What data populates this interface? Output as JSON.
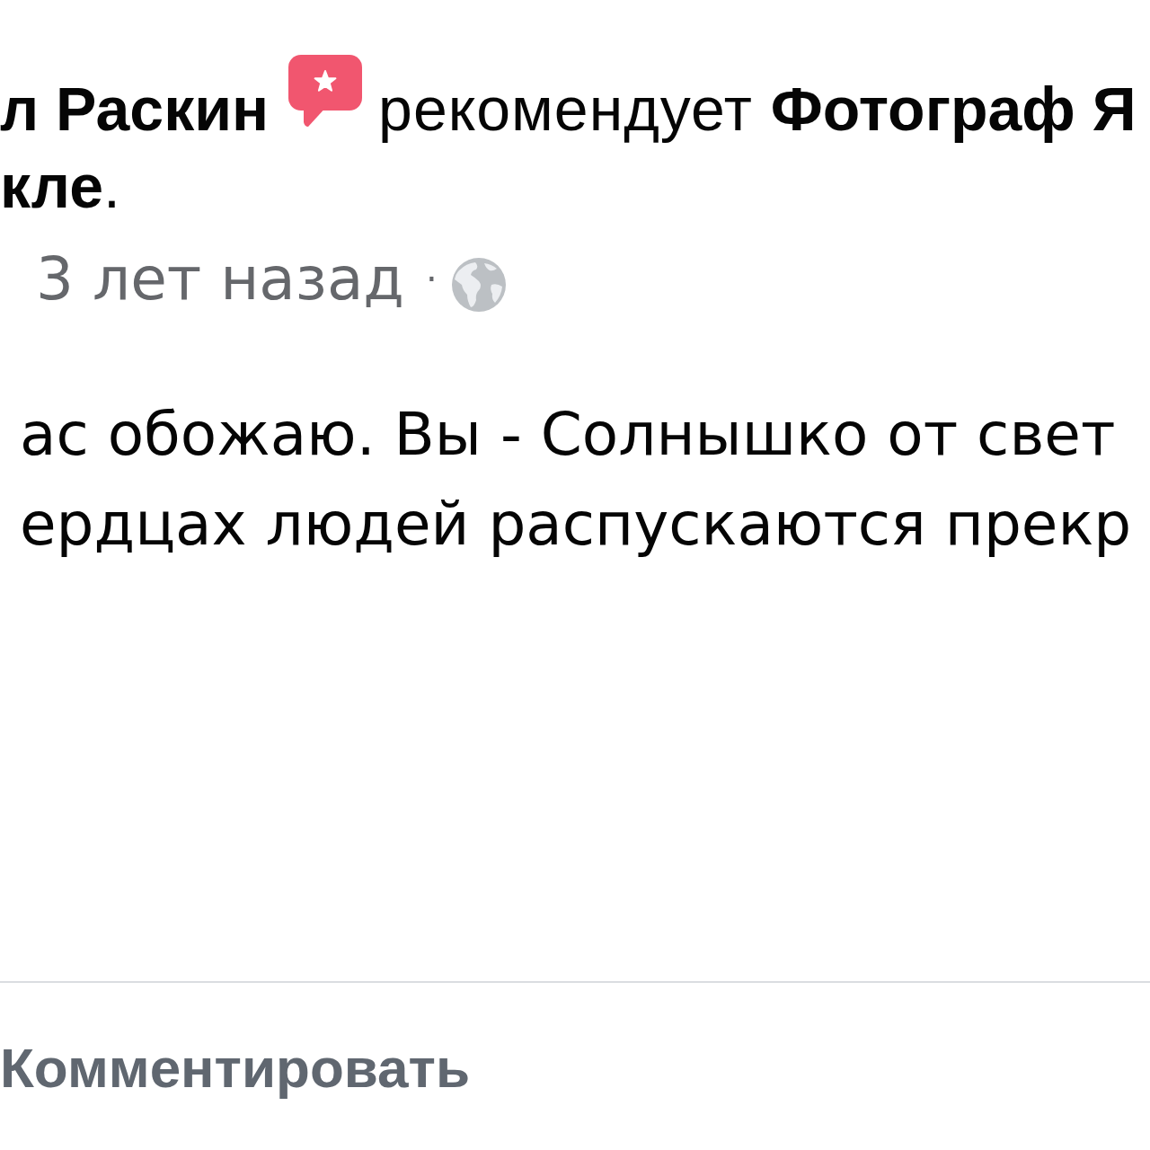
{
  "post": {
    "author": "л Раскин",
    "verb": "рекомендует",
    "page_name": "Фотограф Я",
    "page_name_end": "**кле**.",
    "time": "3 лет назад",
    "separator": "·",
    "text_lines": [
      "ас обожаю. Вы - Солнышко от свет",
      "ердцах людей распускаются прекр"
    ]
  },
  "actions": [
    {
      "label": "Комментировать"
    }
  ]
}
